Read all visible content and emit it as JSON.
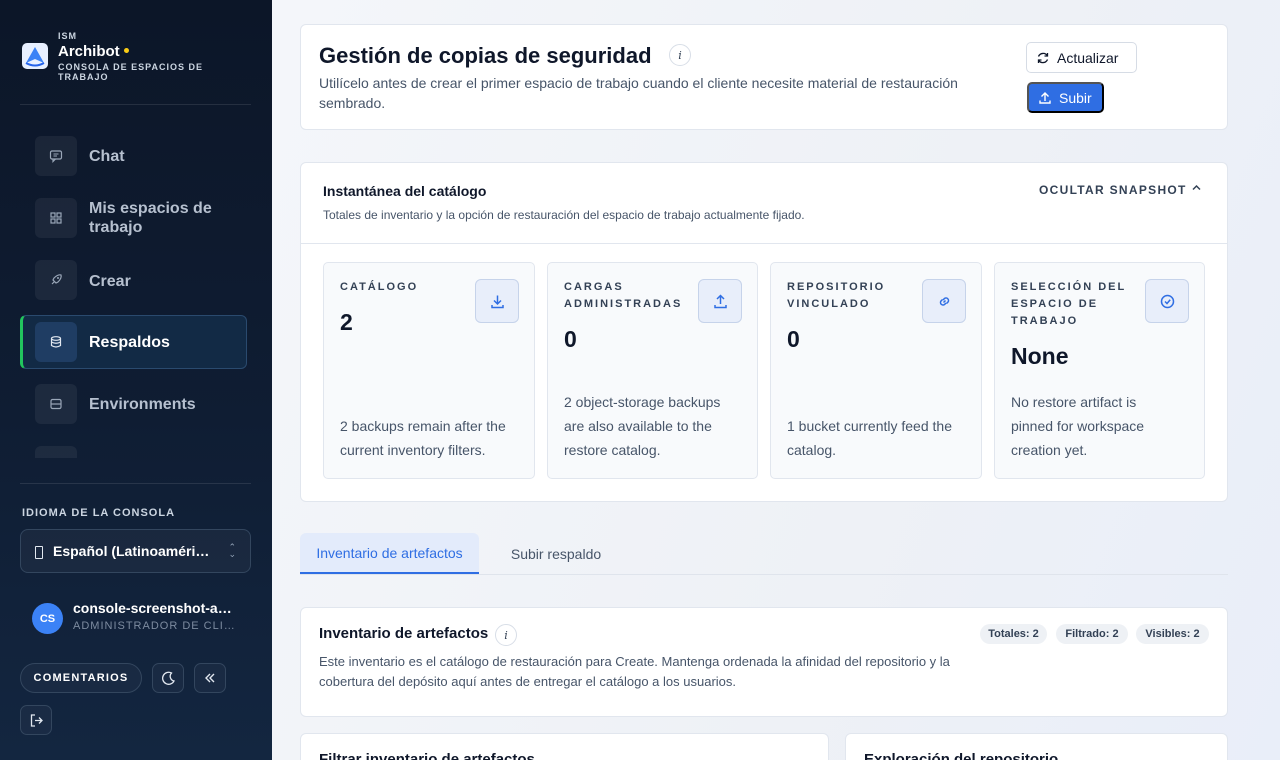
{
  "brand": {
    "kicker": "ISM",
    "name": "Archibot",
    "subtitle": "CONSOLA DE ESPACIOS DE TRABAJO"
  },
  "nav": {
    "items": [
      {
        "label": "Chat",
        "icon": "chat-icon"
      },
      {
        "label": "Mis espacios de trabajo",
        "icon": "grid-icon"
      },
      {
        "label": "Crear",
        "icon": "rocket-icon"
      },
      {
        "label": "Respaldos",
        "icon": "database-icon",
        "active": true
      },
      {
        "label": "Environments",
        "icon": "server-icon"
      }
    ]
  },
  "language": {
    "title": "IDIOMA DE LA CONSOLA",
    "selected": "Español (Latinoamérica)"
  },
  "user": {
    "initials": "CS",
    "name": "console-screenshot-admin",
    "role": "ADMINISTRADOR DE CLIENTE"
  },
  "footer": {
    "feedback_label": "COMENTARIOS"
  },
  "header": {
    "title": "Gestión de copias de seguridad",
    "info": "i",
    "description": "Utilícelo antes de crear el primer espacio de trabajo cuando el cliente necesite material de restauración sembrado.",
    "refresh_label": "Actualizar",
    "upload_label": "Subir"
  },
  "snapshot": {
    "title": "Instantánea del catálogo",
    "subtitle": "Totales de inventario y la opción de restauración del espacio de trabajo actualmente fijado.",
    "toggle_label": "OCULTAR SNAPSHOT",
    "stats": [
      {
        "label": "CATÁLOGO",
        "value": "2",
        "description": "2 backups remain after the current inventory filters.",
        "icon": "download-icon"
      },
      {
        "label": "CARGAS ADMINISTRADAS",
        "value": "0",
        "description": "2 object-storage backups are also available to the restore catalog.",
        "icon": "upload-icon"
      },
      {
        "label": "REPOSITORIO VINCULADO",
        "value": "0",
        "description": "1 bucket currently feed the catalog.",
        "icon": "link-icon"
      },
      {
        "label": "SELECCIÓN DEL ESPACIO DE TRABAJO",
        "value": "None",
        "description": "No restore artifact is pinned for workspace creation yet.",
        "icon": "check-circle-icon"
      }
    ]
  },
  "tabs": [
    {
      "label": "Inventario de artefactos",
      "active": true
    },
    {
      "label": "Subir respaldo",
      "active": false
    }
  ],
  "inventory": {
    "title": "Inventario de artefactos",
    "info": "i",
    "description": "Este inventario es el catálogo de restauración para Create. Mantenga ordenada la afinidad del repositorio y la cobertura del depósito aquí antes de entregar el catálogo a los usuarios.",
    "pills": [
      "Totales: 2",
      "Filtrado: 2",
      "Visibles: 2"
    ]
  },
  "filter_card": {
    "title": "Filtrar inventario de artefactos"
  },
  "repo_card": {
    "title": "Exploración del repositorio"
  },
  "colors": {
    "sidebar_bg": "#0f1d33",
    "accent": "#2f6ee3",
    "active_indicator": "#22c55e",
    "brand_dot": "#facc15",
    "avatar": "#3b82f6"
  }
}
